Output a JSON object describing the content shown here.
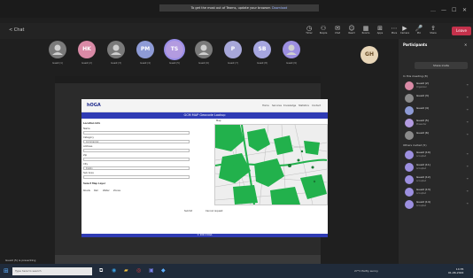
{
  "window": {
    "notice_text": "To get the most out of Teams, update your browser.",
    "notice_action": "Download",
    "controls": [
      "…",
      "—",
      "☐",
      "✕"
    ]
  },
  "toolbar": {
    "back_label": "< Chat",
    "buttons": [
      {
        "icon": "clock-icon",
        "glyph": "◷",
        "label": "Timer"
      },
      {
        "icon": "people-icon",
        "glyph": "⚇",
        "label": "People"
      },
      {
        "icon": "chat-icon",
        "glyph": "✉",
        "label": "Chat"
      },
      {
        "icon": "react-icon",
        "glyph": "☺",
        "label": "React"
      },
      {
        "icon": "rooms-icon",
        "glyph": "▦",
        "label": "Rooms"
      },
      {
        "icon": "apps-icon",
        "glyph": "⊞",
        "label": "Apps"
      },
      {
        "icon": "more-icon",
        "glyph": "⋯",
        "label": "More"
      },
      {
        "icon": "camera-icon",
        "glyph": "▶",
        "label": "Camera"
      },
      {
        "icon": "mic-icon",
        "glyph": "🎤",
        "label": "Mic"
      },
      {
        "icon": "share-icon",
        "glyph": "⇪",
        "label": "Share"
      }
    ],
    "leave_label": "Leave"
  },
  "participants": [
    {
      "initials": "",
      "name": "Guest (1)",
      "color": "#7a7a7a",
      "selected": false
    },
    {
      "initials": "HK",
      "name": "Guest (2)",
      "color": "#d98aa6",
      "selected": false
    },
    {
      "initials": "",
      "name": "Guest (3)",
      "color": "#7a7a7a",
      "selected": false
    },
    {
      "initials": "PM",
      "name": "Guest (4)",
      "color": "#8e9bd6",
      "selected": false
    },
    {
      "initials": "TS",
      "name": "Guest (5)",
      "color": "#b39be0",
      "selected": true
    },
    {
      "initials": "",
      "name": "Guest (6)",
      "color": "#7a7a7a",
      "selected": false
    },
    {
      "initials": "P",
      "name": "Guest (7)",
      "color": "#a7a7d9",
      "selected": false
    },
    {
      "initials": "SB",
      "name": "Guest (8)",
      "color": "#a6a6e0",
      "selected": false
    },
    {
      "initials": "",
      "name": "Guest (9)",
      "color": "#9c8fe0",
      "selected": false
    }
  ],
  "self_avatar": {
    "initials": "GH"
  },
  "shared_screen": {
    "logo": "hOGA",
    "nav": [
      "Home",
      "Services",
      "Knowledge",
      "Statistics",
      "Contact"
    ],
    "title": "GCM MAP Geocode Lookup",
    "form": {
      "section_title": "Location Info",
      "fields": [
        {
          "label": "Name",
          "value": ""
        },
        {
          "label": "Category",
          "value": "Commercial"
        },
        {
          "label": "Address",
          "value": ""
        },
        {
          "label": "Zip",
          "value": ""
        },
        {
          "label": "City",
          "value": "Dublin"
        },
        {
          "label": "Sub Area",
          "value": ""
        }
      ],
      "section2_title": "Select Map Layer",
      "layer_options": [
        "Roads",
        "Rail",
        "Water",
        "Zones"
      ]
    },
    "map_label": "Map",
    "submit_label": "Submit",
    "reset_label": "Cancel request",
    "footer": "© 2021 hOGA",
    "presenter": "Guest (5) is presenting"
  },
  "panel": {
    "title": "Participants",
    "close": "✕",
    "invite_label": "Share invite",
    "section_in_meeting": "In this meeting (8)",
    "in_meeting": [
      {
        "name": "Guest (2)",
        "sub": "Organizer",
        "color": "#d98aa6"
      },
      {
        "name": "Guest (3)",
        "sub": "",
        "color": "#8a8a8a"
      },
      {
        "name": "Guest (4)",
        "sub": "",
        "color": "#8e9bd6"
      },
      {
        "name": "Guest (5)",
        "sub": "Presenter",
        "color": "#b39be0"
      },
      {
        "name": "Guest (6)",
        "sub": "",
        "color": "#8a8a8a"
      }
    ],
    "section_others": "Others invited (5)",
    "others": [
      {
        "name": "Guest (10)",
        "sub": "Accepted",
        "color": "#9c8fe0"
      },
      {
        "name": "Guest (11)",
        "sub": "Accepted",
        "color": "#9c8fe0"
      },
      {
        "name": "Guest (12)",
        "sub": "Accepted",
        "color": "#9c8fe0"
      },
      {
        "name": "Guest (13)",
        "sub": "Accepted",
        "color": "#9c8fe0"
      },
      {
        "name": "Guest (14)",
        "sub": "Accepted",
        "color": "#9c8fe0"
      }
    ]
  },
  "taskbar": {
    "search_placeholder": "Type here to search",
    "icons": [
      {
        "icon": "task-view-icon",
        "glyph": "⧉",
        "color": "#ffffff"
      },
      {
        "icon": "edge-icon",
        "glyph": "◉",
        "color": "#3aa0e0"
      },
      {
        "icon": "explorer-icon",
        "glyph": "▰",
        "color": "#f0c040"
      },
      {
        "icon": "chrome-icon",
        "glyph": "◎",
        "color": "#e04040"
      },
      {
        "icon": "teams-icon",
        "glyph": "▣",
        "color": "#7b83eb"
      },
      {
        "icon": "store-icon",
        "glyph": "◆",
        "color": "#5fb0ff"
      }
    ],
    "weather": "27°C  Partly sunny",
    "time": "14:35",
    "date": "01-06-2022"
  }
}
